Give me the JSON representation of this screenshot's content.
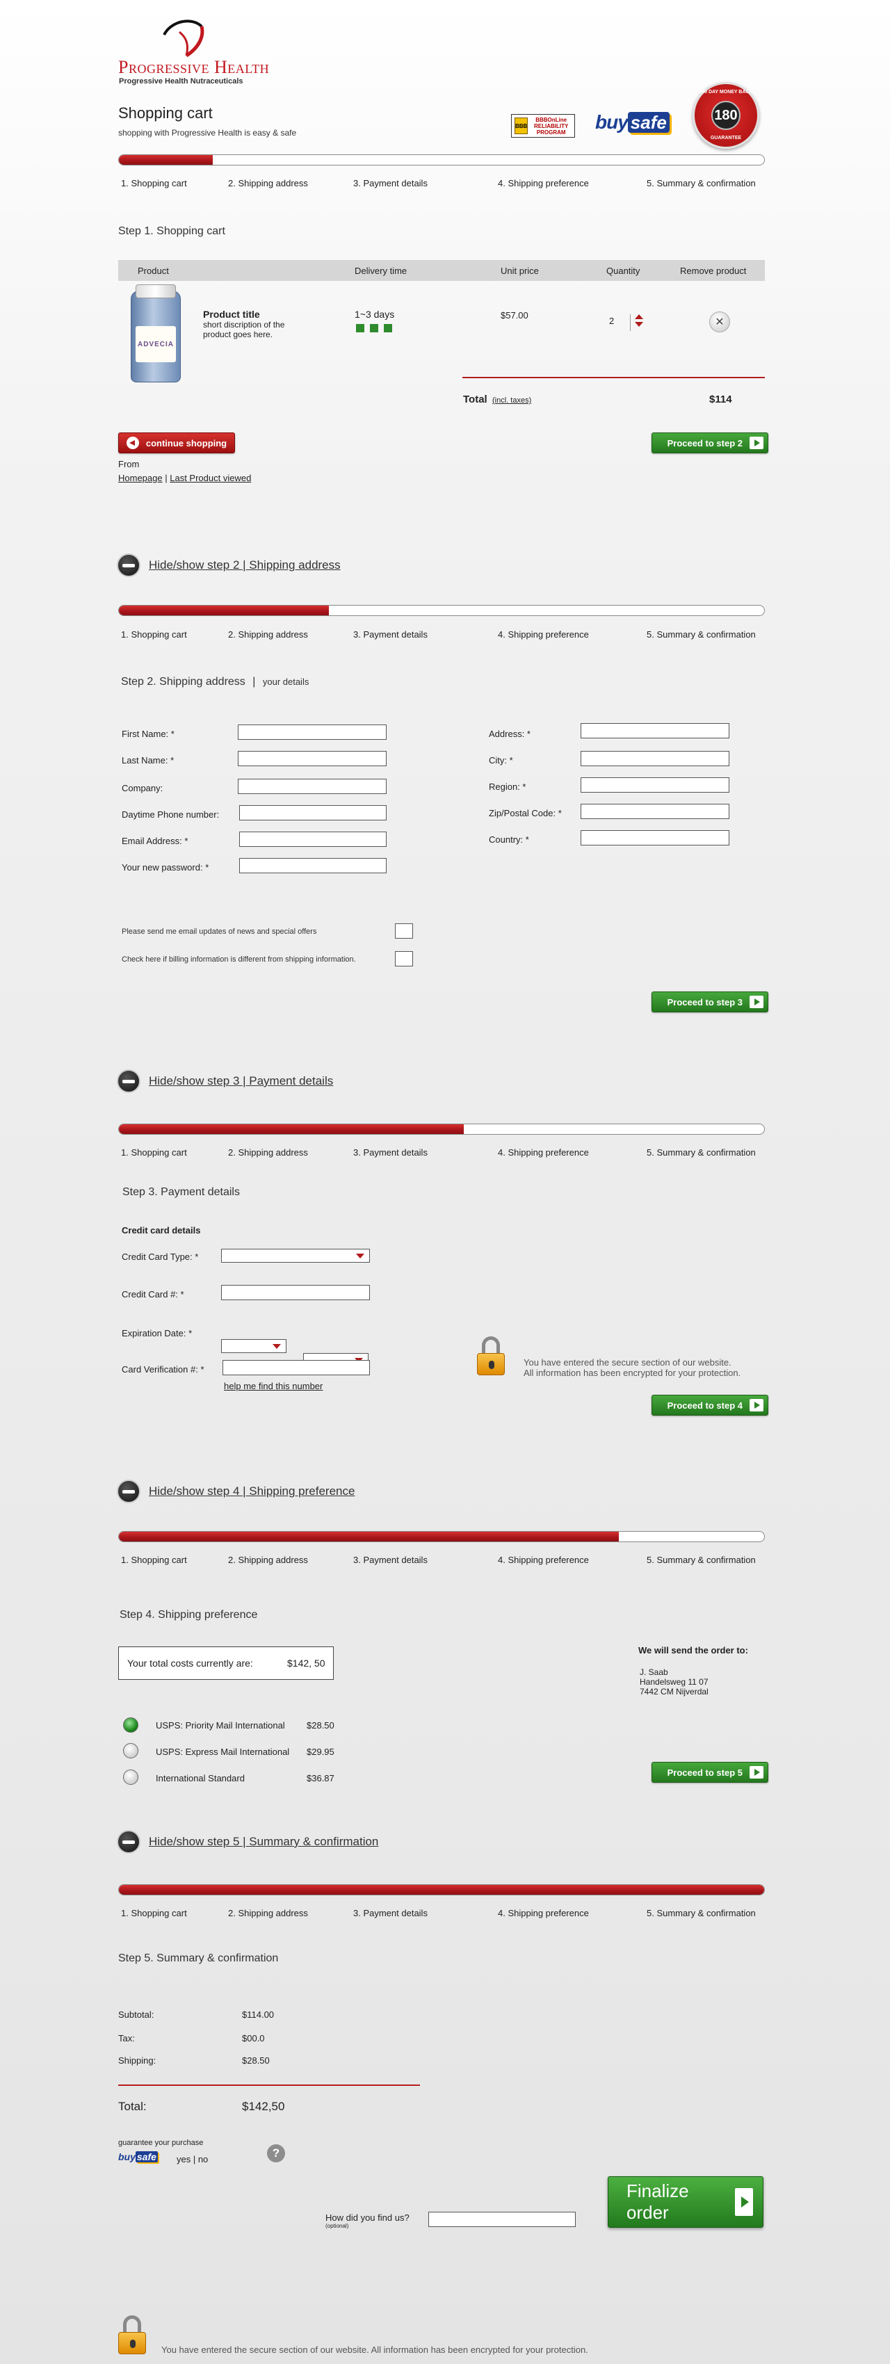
{
  "brand": {
    "name": "Progressive Health",
    "tagline": "Progressive Health Nutraceuticals",
    "accent": "#c2181f"
  },
  "header": {
    "title": "Shopping cart",
    "subtitle": "shopping with Progressive Health is easy & safe",
    "bbb_seal": "BBB",
    "bbb_text": "BBBOnLine RELIABILITY PROGRAM",
    "buysafe_part1": "buy",
    "buysafe_part2": "safe",
    "guarantee_number": "180",
    "guarantee_top": "180 DAY MONEY BACK",
    "guarantee_bottom": "GUARANTEE"
  },
  "steps": [
    "1. Shopping cart",
    "2. Shipping address",
    "3. Payment details",
    "4. Shipping preference",
    "5. Summary & confirmation"
  ],
  "progress": {
    "step1": 0.145,
    "step2": 0.325,
    "step3": 0.535,
    "step4": 0.775,
    "step5": 1.0
  },
  "step1": {
    "heading": "Step 1. Shopping cart",
    "columns": [
      "Product",
      "Delivery time",
      "Unit price",
      "Quantity",
      "Remove product"
    ],
    "product": {
      "image_label": "ADVECIA",
      "title": "Product title",
      "description": "short discription of the product goes here.",
      "delivery": "1~3 days",
      "unit_price": "$57.00",
      "quantity": "2",
      "remove_glyph": "✕"
    },
    "total_label": "Total",
    "total_note": "(incl. taxes)",
    "total_value": "$114",
    "continue_label": "continue shopping",
    "proceed_label": "Proceed to step 2",
    "from_label": "From",
    "from_link1": "Homepage",
    "from_sep": "|",
    "from_link2": "Last Product viewed"
  },
  "step2": {
    "toggle": "Hide/show step 2 | Shipping address",
    "heading": "Step 2. Shipping address",
    "heading_sep": "|",
    "heading_note": "your details",
    "left_fields": [
      "First Name: *",
      "Last Name: *",
      "Company:",
      "Daytime Phone number:",
      "Email Address: *",
      "Your new password: *"
    ],
    "right_fields": [
      "Address: *",
      "City: *",
      "Region: *",
      "Zip/Postal Code: *",
      "Country: *"
    ],
    "check_news": "Please send me email updates of news and special offers",
    "check_billing": "Check here if billing information is different from shipping information.",
    "proceed_label": "Proceed to step 3"
  },
  "step3": {
    "toggle": "Hide/show step 3 | Payment details",
    "heading": "Step 3. Payment details",
    "subheading": "Credit card details",
    "card_type": "Credit Card Type: *",
    "card_number": "Credit Card #: *",
    "expiration": "Expiration Date: *",
    "verification": "Card Verification #: *",
    "help_link": "help me find this number",
    "secure_line1": "You have entered the secure section of our website.",
    "secure_line2": "All information has been encrypted for your protection.",
    "proceed_label": "Proceed to step 4"
  },
  "step4": {
    "toggle": "Hide/show step 4 | Shipping preference",
    "heading": "Step 4. Shipping preference",
    "total_label": "Your total costs currently are:",
    "total_value": "$142, 50",
    "send_to_label": "We will send the order to:",
    "address": [
      "J. Saab",
      "Handelsweg 11 07",
      "7442 CM Nijverdal"
    ],
    "options": [
      {
        "label": "USPS: Priority Mail International",
        "price": "$28.50",
        "selected": true
      },
      {
        "label": "USPS: Express Mail International",
        "price": "$29.95",
        "selected": false
      },
      {
        "label": "International Standard",
        "price": "$36.87",
        "selected": false
      }
    ],
    "proceed_label": "Proceed to step 5"
  },
  "step5": {
    "toggle": "Hide/show step 5 | Summary & confirmation",
    "heading": "Step 5. Summary & confirmation",
    "subtotal_label": "Subtotal:",
    "subtotal_value": "$114.00",
    "tax_label": "Tax:",
    "tax_value": "$00.0",
    "shipping_label": "Shipping:",
    "shipping_value": "$28.50",
    "total_label": "Total:",
    "total_value": "$142,50",
    "guarantee_label": "guarantee your purchase",
    "buysafe_mini1": "buy",
    "buysafe_mini2": "safe",
    "yes_no": "yes | no",
    "help_glyph": "?",
    "find_label": "How did you find us?",
    "find_note": "(optional)",
    "finalize_label": "Finalize order",
    "footer_secure": "You have entered the secure section of our website. All information has been encrypted for your protection."
  }
}
